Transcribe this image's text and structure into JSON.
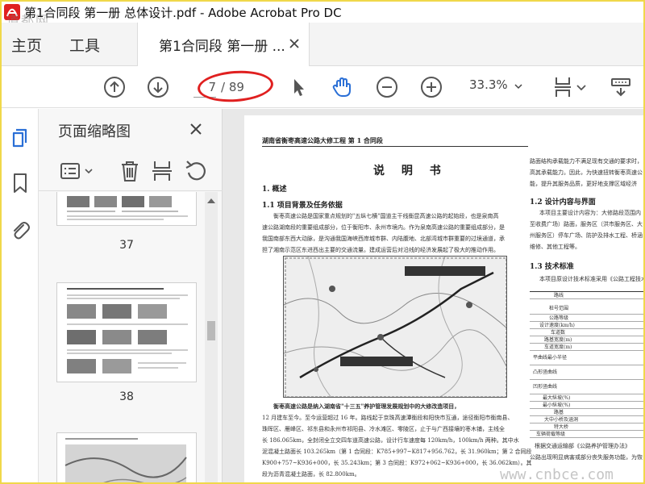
{
  "window": {
    "title": "第1合同段 第一册 总体设计.pdf - Adobe Acrobat Pro DC",
    "watermark": "道都网"
  },
  "tabs": {
    "home": "主页",
    "tools": "工具",
    "document": "第1合同段 第一册 ..."
  },
  "toolbar": {
    "page_current": "7",
    "page_total": "/ 89",
    "zoom": "33.3%",
    "icons": [
      "scroll-up-icon",
      "scroll-down-icon",
      "select-pointer-icon",
      "hand-tool-icon",
      "zoom-out-icon",
      "zoom-in-icon",
      "page-layout-icon",
      "tools-menu-icon"
    ],
    "accent_color": "#2a6fd6"
  },
  "thumbnails": {
    "title": "页面缩略图",
    "pages": [
      {
        "label": "37"
      },
      {
        "label": "38"
      }
    ]
  },
  "document": {
    "header": "湖南省衡枣高速公路大修工程 第 1 合同段",
    "title": "说 明 书",
    "sections": [
      {
        "heading": "1. 概述"
      },
      {
        "heading": "1.1 项目背景及任务依据"
      },
      {
        "heading": "1.2 设计内容与界面"
      },
      {
        "heading": "1.3 技术标准"
      }
    ],
    "paragraphs": [
      "衡枣高速公路是国家重点规划的\"五纵七横\"国道主干线衡昆高速公路的起始段，也是泉南高",
      "速公路湖南段的重要组成部分，位于衡阳市、永州市境内。作为泉南高速公路的重要组成部分，是",
      "我国南部东西大动脉，是沟通我国海峡西岸城市群、内陆腹地、北部湾城市群重要的过境通道，承",
      "担了湘南示范区东进西出主要的交通流量。建成运营后对沿线的经济发展起了极大的推动作用。"
    ],
    "map_caption": "衡枣高速公路是纳入湖南省\"十三五\"养护管理发展规划中的大修改造项目，",
    "right_column": [
      "路面结构承载能力不满足现有交通的要求时，",
      "高其承载能力。因此，为快速扭转衡枣高速公",
      "能，提升其服务品质，更好地支撑区域经济"
    ],
    "right_design": [
      "本项目主要设计内容为：大修路段范围内",
      "至收费广场）路面，服务区（洪市服务区、大",
      "州服务区）停车广场、防护及排水工程、桥涵",
      "维修、其他工程等。"
    ],
    "right_standard": "本项目原设计技术标准采用《公路工程技术",
    "table_rows": [
      "路线",
      "桩号范围",
      "公路等级",
      "设计速度(km/h)",
      "车道数",
      "路基宽度(m)",
      "车道宽度(m)",
      "平曲线最小半径",
      "凸形竖曲线",
      "凹形竖曲线",
      "最大纵坡(%)",
      "最小纵坡(%)",
      "路基",
      "大中小桥及涵洞",
      "特大桥",
      "车辆荷载等级"
    ],
    "bottom_lines": [
      "12 月建车至今。至今运营超过 16 年。路线起于京珠高速潭衡段和阳快市互通，途径衡阳市衡南县、",
      "珠晖区、雁峰区、祁东县和永州市祁阳县、冷水滩区、零陵区，止于与广西接壤的枣木铺，主线全",
      "长 186.065km，全封闭全立交四车道高速公路，设计行车速度每 120km/h，100km/h 两种。其中水",
      "泥混凝土路面长 103.265km（第 1 合同段：K785+997~K817+956.762，长 31.960km；第 2 合同段：",
      "K900+757~K936+000，长 35.243km；第 3 合同段：K972+062~K936+000，长 36.062km）。其余路",
      "段为沥青混凝土路面，长 82.800km。"
    ],
    "right_bottom": [
      "根据交通运输部《公路养护管理办法》",
      "公路出现明显病害或部分丧失服务功能，为恢"
    ],
    "site_watermark": "www.cnbce.com"
  }
}
